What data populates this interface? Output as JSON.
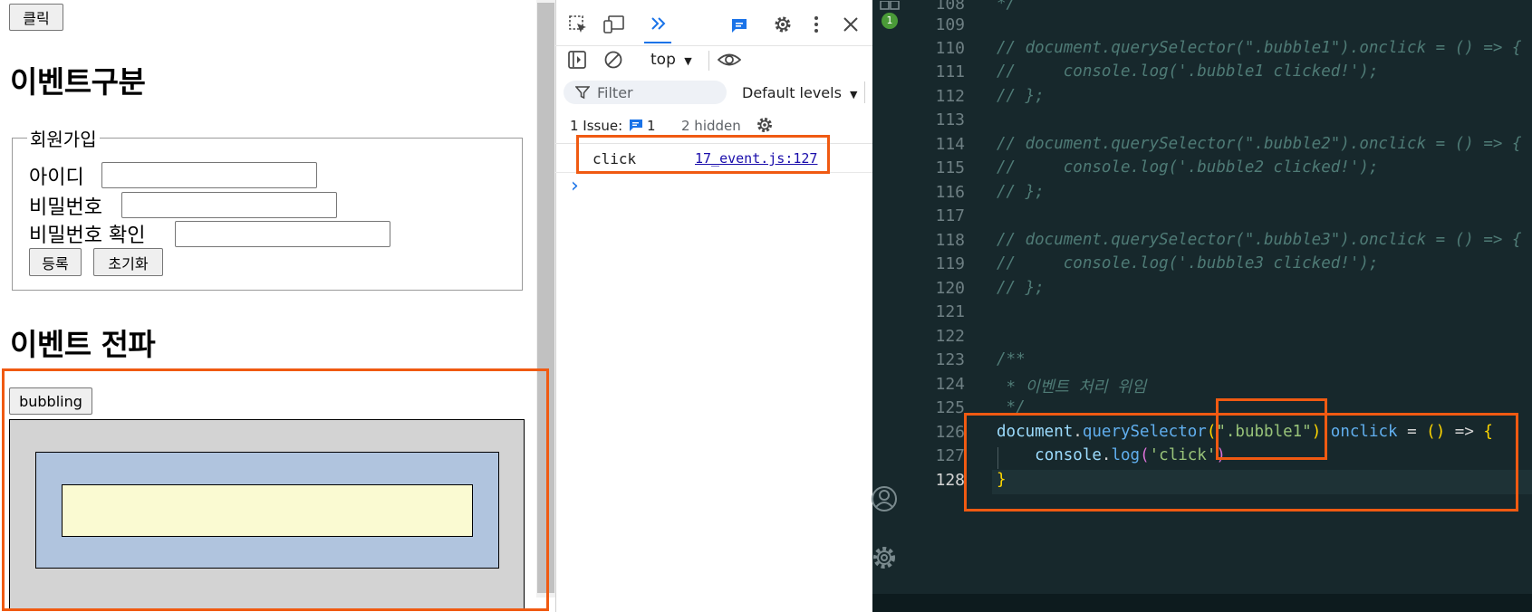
{
  "browser_page": {
    "click_button": "클릭",
    "heading_event_types": "이벤트구분",
    "signup_form": {
      "legend": "회원가입",
      "id_label": "아이디",
      "password_label": "비밀번호",
      "password_confirm_label": "비밀번호 확인",
      "id_value": "",
      "password_value": "",
      "password_confirm_value": "",
      "submit_button": "등록",
      "reset_button": "초기화"
    },
    "heading_propagation": "이벤트 전파",
    "bubbling_button": "bubbling",
    "colors": {
      "bubble1": "#d3d3d3",
      "bubble2": "#b0c4de",
      "bubble3": "#fafad2"
    }
  },
  "devtools": {
    "context_select": "top",
    "filter_placeholder": "Filter",
    "levels_select": "Default levels",
    "issues_label": "1 Issue:",
    "issues_count": "1",
    "hidden_label": "2 hidden",
    "console_entries": [
      {
        "message": "click",
        "source": "17_event.js:127"
      }
    ],
    "prompt_glyph": "›"
  },
  "editor": {
    "notification_badge": "1",
    "lines": [
      {
        "num": "108",
        "text": "*/"
      },
      {
        "num": "109",
        "text": ""
      },
      {
        "num": "110",
        "text": "// document.querySelector(\".bubble1\").onclick = () => {"
      },
      {
        "num": "111",
        "text": "//     console.log('.bubble1 clicked!');"
      },
      {
        "num": "112",
        "text": "// };"
      },
      {
        "num": "113",
        "text": ""
      },
      {
        "num": "114",
        "text": "// document.querySelector(\".bubble2\").onclick = () => {"
      },
      {
        "num": "115",
        "text": "//     console.log('.bubble2 clicked!');"
      },
      {
        "num": "116",
        "text": "// };"
      },
      {
        "num": "117",
        "text": ""
      },
      {
        "num": "118",
        "text": "// document.querySelector(\".bubble3\").onclick = () => {"
      },
      {
        "num": "119",
        "text": "//     console.log('.bubble3 clicked!');"
      },
      {
        "num": "120",
        "text": "// };"
      },
      {
        "num": "121",
        "text": ""
      },
      {
        "num": "122",
        "text": ""
      },
      {
        "num": "123",
        "text": "/**"
      },
      {
        "num": "124",
        "text": " * 이벤트 처리 위임"
      },
      {
        "num": "125",
        "text": " */"
      },
      {
        "num": "126",
        "text": "document.querySelector(\".bubble1\").onclick = () => {"
      },
      {
        "num": "127",
        "text": "    console.log('click')"
      },
      {
        "num": "128",
        "text": "}"
      }
    ],
    "code126": {
      "obj": "document",
      "dot": ".",
      "method": "querySelector",
      "open": "(",
      "selector": "\".bubble1\"",
      "close": ")",
      "prop": ".onclick",
      "assign": " = ",
      "arrow_params": "()",
      "arrow": " => ",
      "brace": "{"
    },
    "code127": {
      "indent": "    ",
      "obj": "console",
      "dot": ".",
      "method": "log",
      "open": "(",
      "str": "'click'",
      "close": ")"
    },
    "code128": {
      "brace": "}"
    }
  },
  "annotation_color": "#f05a12"
}
